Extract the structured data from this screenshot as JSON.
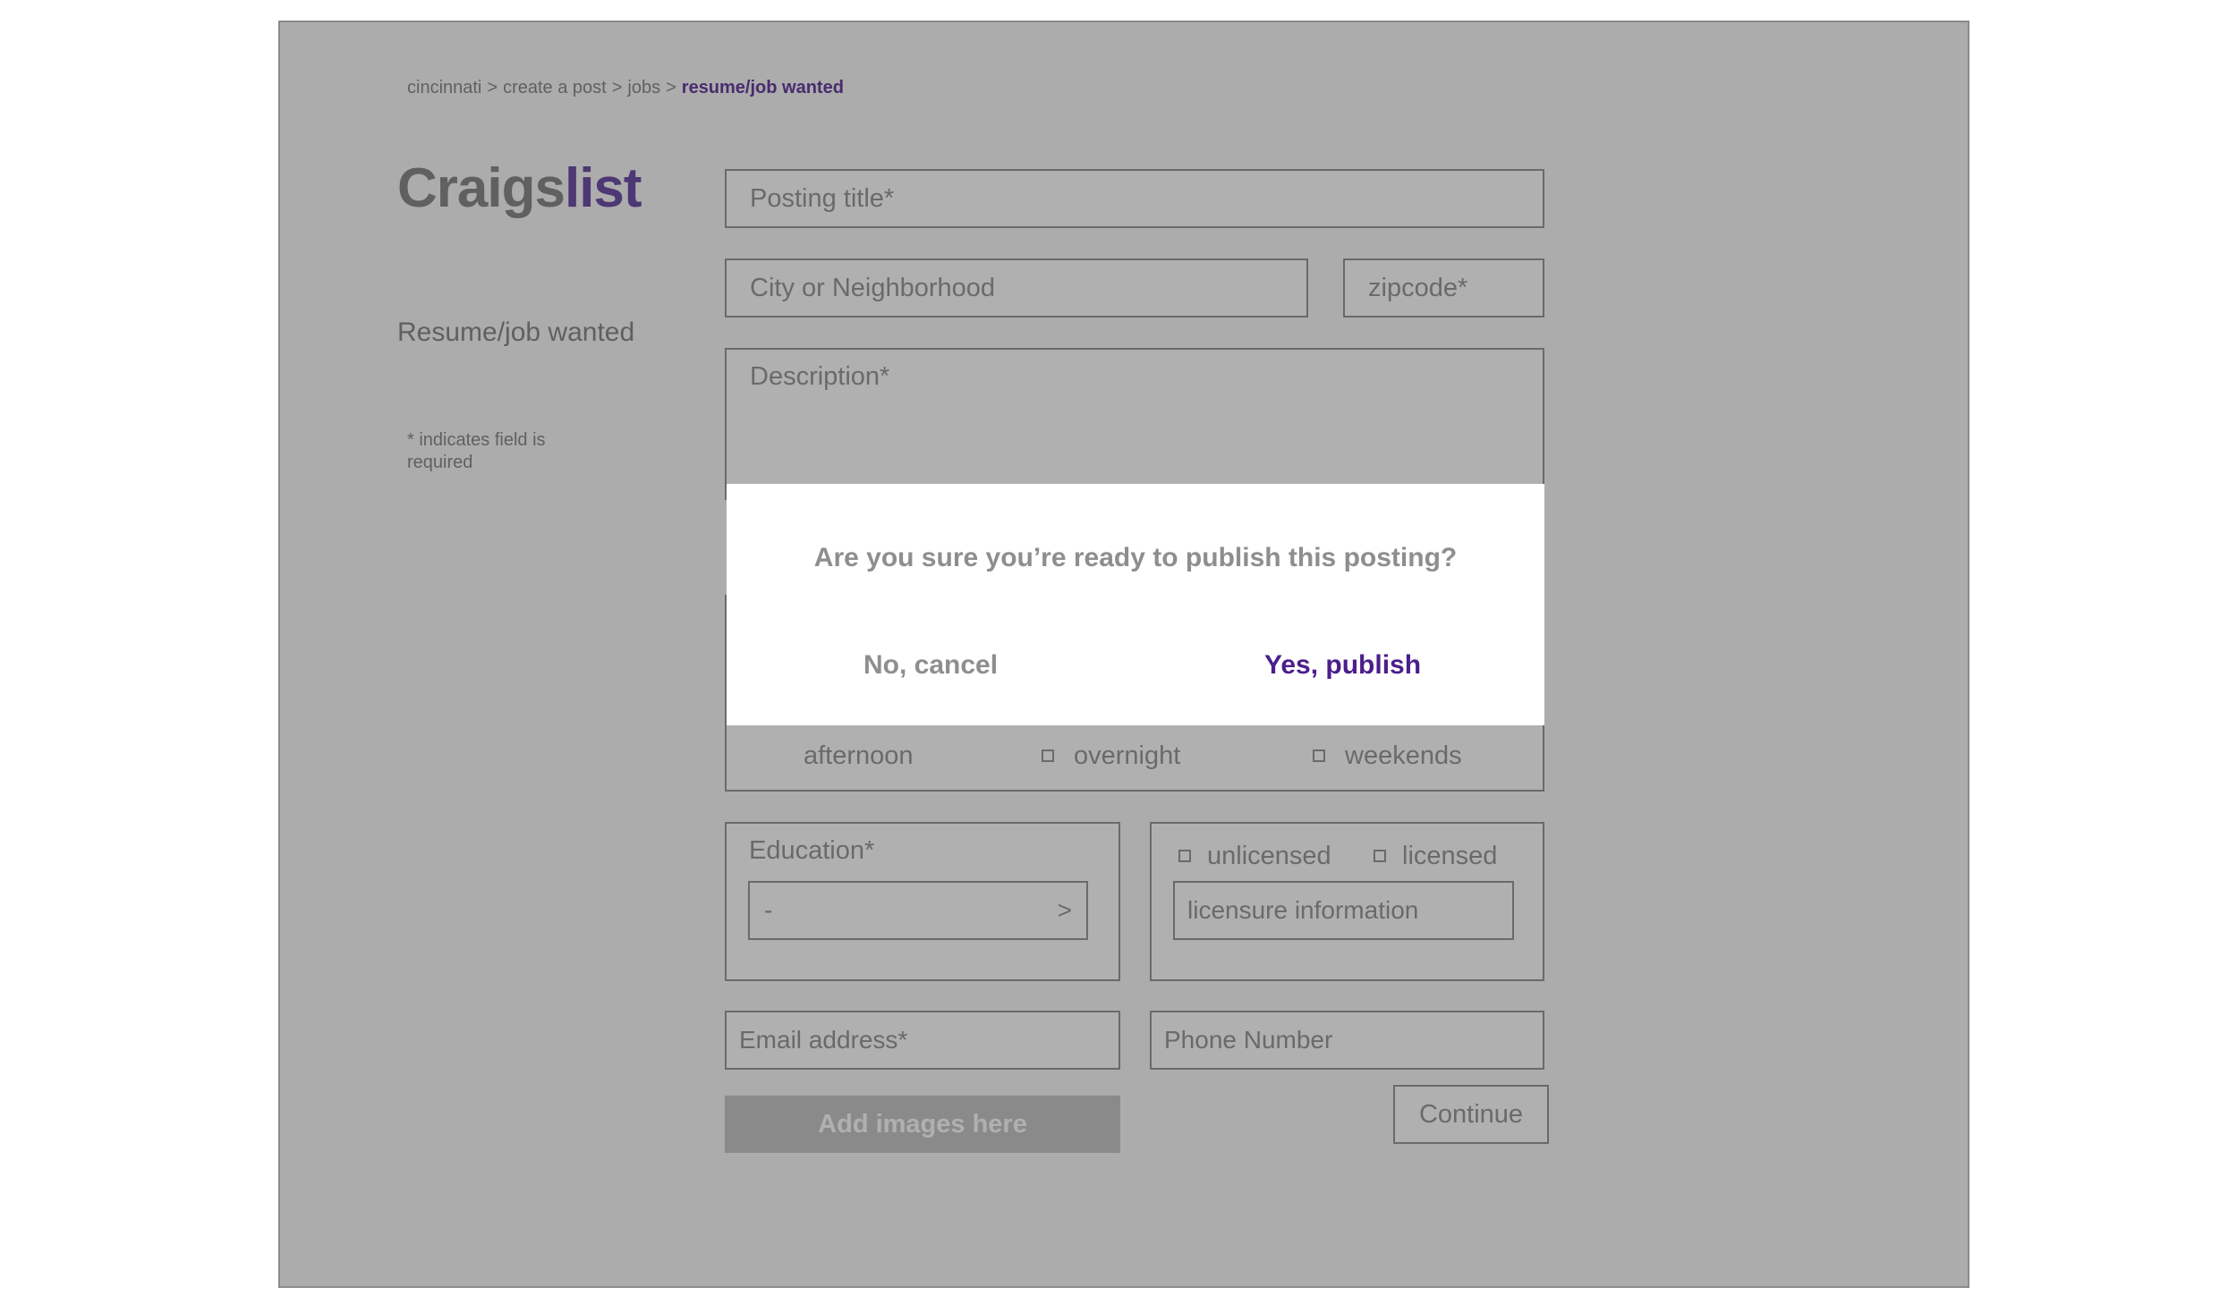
{
  "breadcrumb": {
    "items": [
      "cincinnati",
      "create a post",
      "jobs"
    ],
    "separator": ">",
    "current": "resume/job wanted"
  },
  "logo": {
    "part1": "Craigs",
    "part2": "list"
  },
  "category_heading": "Resume/job wanted",
  "required_note": "* indicates field is required",
  "form": {
    "posting_title_placeholder": "Posting title*",
    "city_placeholder": "City or Neighborhood",
    "zipcode_placeholder": "zipcode*",
    "description_placeholder": "Description*",
    "availability": {
      "afternoon": "afternoon",
      "overnight": "overnight",
      "weekends": "weekends"
    },
    "education": {
      "label": "Education*",
      "selected": "-",
      "chevron": ">"
    },
    "license": {
      "unlicensed": "unlicensed",
      "licensed": "licensed",
      "info_placeholder": "licensure information"
    },
    "email_placeholder": "Email address*",
    "phone_placeholder": "Phone Number",
    "add_images_label": "Add images here",
    "continue_label": "Continue"
  },
  "dialog": {
    "question": "Are you sure you’re ready to publish this posting?",
    "cancel_label": "No, cancel",
    "publish_label": "Yes, publish"
  },
  "colors": {
    "accent": "#6a3fa0",
    "publish": "#4b1e8c",
    "overlay": "rgba(0,0,0,0.31)"
  }
}
